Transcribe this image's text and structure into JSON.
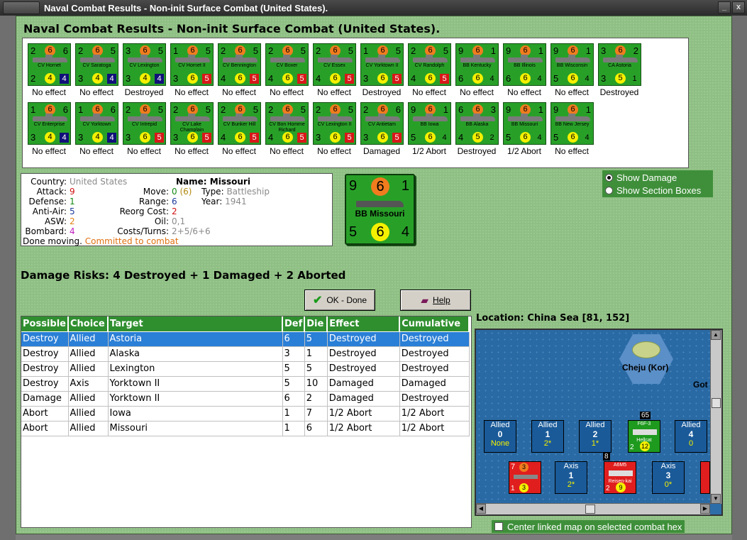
{
  "window": {
    "title": "Naval Combat Results - Non-init Surface Combat (United States).",
    "minimize": "_",
    "close": "x"
  },
  "heading": "Naval Combat Results - Non-init Surface Combat (United States).",
  "row1": [
    {
      "name": "CV Hornet",
      "tl": "2",
      "top": "6",
      "tr": "6",
      "bl": "2",
      "bot": "4",
      "sq": "4",
      "sqc": "blue",
      "result": "No effect"
    },
    {
      "name": "CV Saratoga",
      "tl": "2",
      "top": "6",
      "tr": "5",
      "bl": "3",
      "bot": "4",
      "sq": "4",
      "sqc": "blue",
      "result": "No effect"
    },
    {
      "name": "CV Lexington",
      "tl": "3",
      "top": "6",
      "tr": "5",
      "bl": "3",
      "bot": "4",
      "sq": "4",
      "sqc": "blue",
      "result": "Destroyed"
    },
    {
      "name": "CV Hornet II",
      "tl": "1",
      "top": "6",
      "tr": "5",
      "bl": "3",
      "bot": "6",
      "sq": "5",
      "sqc": "red",
      "result": "No effect"
    },
    {
      "name": "CV Bennington",
      "tl": "2",
      "top": "6",
      "tr": "5",
      "bl": "4",
      "bot": "6",
      "sq": "5",
      "sqc": "red",
      "result": "No effect"
    },
    {
      "name": "CV Boxer",
      "tl": "2",
      "top": "6",
      "tr": "5",
      "bl": "4",
      "bot": "6",
      "sq": "5",
      "sqc": "red",
      "result": "No effect"
    },
    {
      "name": "CV Essex",
      "tl": "2",
      "top": "6",
      "tr": "5",
      "bl": "4",
      "bot": "6",
      "sq": "5",
      "sqc": "red",
      "result": "No effect"
    },
    {
      "name": "CV Yorktown II",
      "tl": "1",
      "top": "6",
      "tr": "5",
      "bl": "3",
      "bot": "6",
      "sq": "5",
      "sqc": "red",
      "result": "Destroyed"
    },
    {
      "name": "CV Randolph",
      "tl": "2",
      "top": "6",
      "tr": "5",
      "bl": "4",
      "bot": "6",
      "sq": "5",
      "sqc": "red",
      "result": "No effect"
    },
    {
      "name": "BB Kentucky",
      "tl": "9",
      "top": "6",
      "tr": "1",
      "bl": "6",
      "bot": "6",
      "sq": "4",
      "sqc": "none",
      "result": "No effect"
    },
    {
      "name": "BB Illinois",
      "tl": "9",
      "top": "6",
      "tr": "1",
      "bl": "6",
      "bot": "6",
      "sq": "4",
      "sqc": "none",
      "result": "No effect"
    },
    {
      "name": "BB Wisconsin",
      "tl": "9",
      "top": "6",
      "tr": "1",
      "bl": "5",
      "bot": "6",
      "sq": "4",
      "sqc": "none",
      "result": "No effect"
    },
    {
      "name": "CA Astoria",
      "tl": "3",
      "top": "6",
      "tr": "2",
      "bl": "3",
      "bot": "5",
      "sq": "1",
      "sqc": "none",
      "result": "Destroyed"
    }
  ],
  "row2": [
    {
      "name": "CV Enterprise",
      "tl": "1",
      "top": "6",
      "tr": "6",
      "bl": "3",
      "bot": "4",
      "sq": "4",
      "sqc": "blue",
      "result": "No effect"
    },
    {
      "name": "CV Yorktown",
      "tl": "1",
      "top": "6",
      "tr": "6",
      "bl": "3",
      "bot": "4",
      "sq": "4",
      "sqc": "blue",
      "result": "No effect"
    },
    {
      "name": "CV Intrepid",
      "tl": "2",
      "top": "6",
      "tr": "5",
      "bl": "3",
      "bot": "6",
      "sq": "5",
      "sqc": "red",
      "result": "No effect"
    },
    {
      "name": "CV Lake Champlain",
      "tl": "2",
      "top": "6",
      "tr": "5",
      "bl": "3",
      "bot": "6",
      "sq": "5",
      "sqc": "red",
      "result": "No effect"
    },
    {
      "name": "CV Bunker Hill",
      "tl": "2",
      "top": "6",
      "tr": "5",
      "bl": "4",
      "bot": "6",
      "sq": "5",
      "sqc": "red",
      "result": "No effect"
    },
    {
      "name": "CV Bon Homme Richard",
      "tl": "2",
      "top": "6",
      "tr": "5",
      "bl": "4",
      "bot": "6",
      "sq": "5",
      "sqc": "red",
      "result": "No effect"
    },
    {
      "name": "CV Lexington II",
      "tl": "2",
      "top": "6",
      "tr": "5",
      "bl": "3",
      "bot": "6",
      "sq": "5",
      "sqc": "red",
      "result": "No effect"
    },
    {
      "name": "CV Antietam",
      "tl": "2",
      "top": "6",
      "tr": "6",
      "bl": "3",
      "bot": "6",
      "sq": "5",
      "sqc": "red",
      "result": "Damaged"
    },
    {
      "name": "BB Iowa",
      "tl": "9",
      "top": "6",
      "tr": "1",
      "bl": "5",
      "bot": "6",
      "sq": "4",
      "sqc": "none",
      "result": "1/2 Abort"
    },
    {
      "name": "BB Alaska",
      "tl": "6",
      "top": "6",
      "tr": "3",
      "bl": "4",
      "bot": "5",
      "sq": "2",
      "sqc": "none",
      "result": "Destroyed"
    },
    {
      "name": "BB Missouri",
      "tl": "9",
      "top": "6",
      "tr": "1",
      "bl": "5",
      "bot": "6",
      "sq": "4",
      "sqc": "none",
      "result": "1/2 Abort"
    },
    {
      "name": "BB New Jersey",
      "tl": "9",
      "top": "6",
      "tr": "1",
      "bl": "5",
      "bot": "6",
      "sq": "4",
      "sqc": "none",
      "result": "No effect"
    }
  ],
  "info": {
    "country_label": "Country:",
    "country": "United States",
    "attack_label": "Attack:",
    "attack": "9",
    "defense_label": "Defense:",
    "defense": "1",
    "antiair_label": "Anti-Air:",
    "antiair": "5",
    "asw_label": "ASW:",
    "asw": "2",
    "bombard_label": "Bombard:",
    "bombard": "4",
    "name_label": "Name:",
    "name": "Missouri",
    "move_label": "Move:",
    "move": "0",
    "move_paren": "(6)",
    "type_label": "Type:",
    "type": "Battleship",
    "range_label": "Range:",
    "range": "6",
    "year_label": "Year:",
    "year": "1941",
    "reorg_label": "Reorg Cost:",
    "reorg": "2",
    "oil_label": "Oil:",
    "oil": "0,1",
    "costs_label": "Costs/Turns:",
    "costs": "2+5/6+6",
    "done": "Done moving.",
    "committed": "Committed to combat"
  },
  "big_counter": {
    "tl": "9",
    "top": "6",
    "tr": "1",
    "name": "BB Missouri",
    "bl": "5",
    "bot": "6",
    "br": "4"
  },
  "radios": {
    "show_damage": "Show Damage",
    "show_sections": "Show Section Boxes"
  },
  "damage_risks": "Damage Risks:  4 Destroyed + 1 Damaged + 2 Aborted",
  "buttons": {
    "ok": "OK - Done",
    "help": "Help"
  },
  "table": {
    "headers": [
      "Possible",
      "Choice",
      "Target",
      "Def",
      "Die",
      "Effect",
      "Cumulative"
    ],
    "rows": [
      [
        "Destroy",
        "Allied",
        "Astoria",
        "6",
        "5",
        "Destroyed",
        "Destroyed"
      ],
      [
        "Destroy",
        "Allied",
        "Alaska",
        "3",
        "1",
        "Destroyed",
        "Destroyed"
      ],
      [
        "Destroy",
        "Allied",
        "Lexington",
        "5",
        "5",
        "Destroyed",
        "Destroyed"
      ],
      [
        "Destroy",
        "Axis",
        "Yorktown II",
        "5",
        "10",
        "Damaged",
        "Damaged"
      ],
      [
        "Damage",
        "Allied",
        "Yorktown II",
        "6",
        "2",
        "Damaged",
        "Destroyed"
      ],
      [
        "Abort",
        "Allied",
        "Iowa",
        "1",
        "7",
        "1/2 Abort",
        "1/2 Abort"
      ],
      [
        "Abort",
        "Allied",
        "Missouri",
        "1",
        "6",
        "1/2 Abort",
        "1/2 Abort"
      ]
    ]
  },
  "location": "Location:  China Sea [81, 152]",
  "map": {
    "place": "Cheju (Kor)",
    "place2": "Got",
    "allied_label": "Allied",
    "axis_label": "Axis",
    "allied_boxes": [
      {
        "num": "0",
        "val": "None"
      },
      {
        "num": "1",
        "val": "2*"
      },
      {
        "num": "2",
        "val": "1*"
      },
      {
        "num": "4",
        "val": "0"
      }
    ],
    "axis_boxes": [
      {
        "num": "1",
        "val": "2*"
      },
      {
        "num": "3",
        "val": "0*"
      }
    ],
    "green_unit": {
      "count": "65",
      "name": "F6F-3",
      "sub": "Hellcat",
      "a": "2",
      "b": "12"
    },
    "red_unit1": {
      "a": "7",
      "b": "3",
      "c": "1",
      "d": "3"
    },
    "red_unit2": {
      "count": "8",
      "name": "A6M5",
      "sub": "Reisen-kai",
      "a": "2",
      "b": "9"
    }
  },
  "center_check": "Center linked map on selected combat hex"
}
